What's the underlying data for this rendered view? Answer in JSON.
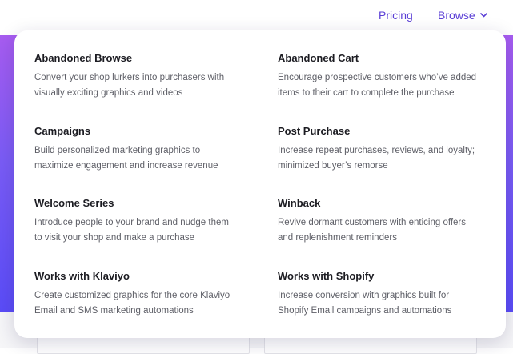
{
  "nav": {
    "pricing_label": "Pricing",
    "browse_label": "Browse"
  },
  "colors": {
    "accent": "#5b3fd6",
    "hero_top": "#a75cf0",
    "hero_bottom": "#5a4cf7"
  },
  "icons": {
    "browse_caret": "chevron-down-icon"
  },
  "menu": {
    "items": [
      {
        "title": "Abandoned Browse",
        "desc_line1": "Convert your shop lurkers into purchasers with",
        "desc_line2": "visually exciting graphics and videos"
      },
      {
        "title": "Abandoned Cart",
        "desc_line1": "Encourage prospective customers who’ve added",
        "desc_line2": "items to their cart to complete the purchase"
      },
      {
        "title": "Campaigns",
        "desc_line1": "Build personalized marketing graphics to",
        "desc_line2": "maximize engagement and increase revenue"
      },
      {
        "title": "Post Purchase",
        "desc_line1": "Increase repeat purchases, reviews, and loyalty;",
        "desc_line2": "minimized buyer’s remorse"
      },
      {
        "title": "Welcome Series",
        "desc_line1": "Introduce people to your brand and nudge them",
        "desc_line2": "to visit your shop and make a purchase"
      },
      {
        "title": "Winback",
        "desc_line1": "Revive dormant customers with enticing offers",
        "desc_line2": "and replenishment reminders"
      },
      {
        "title": "Works with Klaviyo",
        "desc_line1": "Create customized graphics for the core Klaviyo",
        "desc_line2": "Email and SMS marketing automations"
      },
      {
        "title": "Works with Shopify",
        "desc_line1": "Increase conversion with graphics built for",
        "desc_line2": "Shopify Email campaigns and automations"
      }
    ]
  }
}
